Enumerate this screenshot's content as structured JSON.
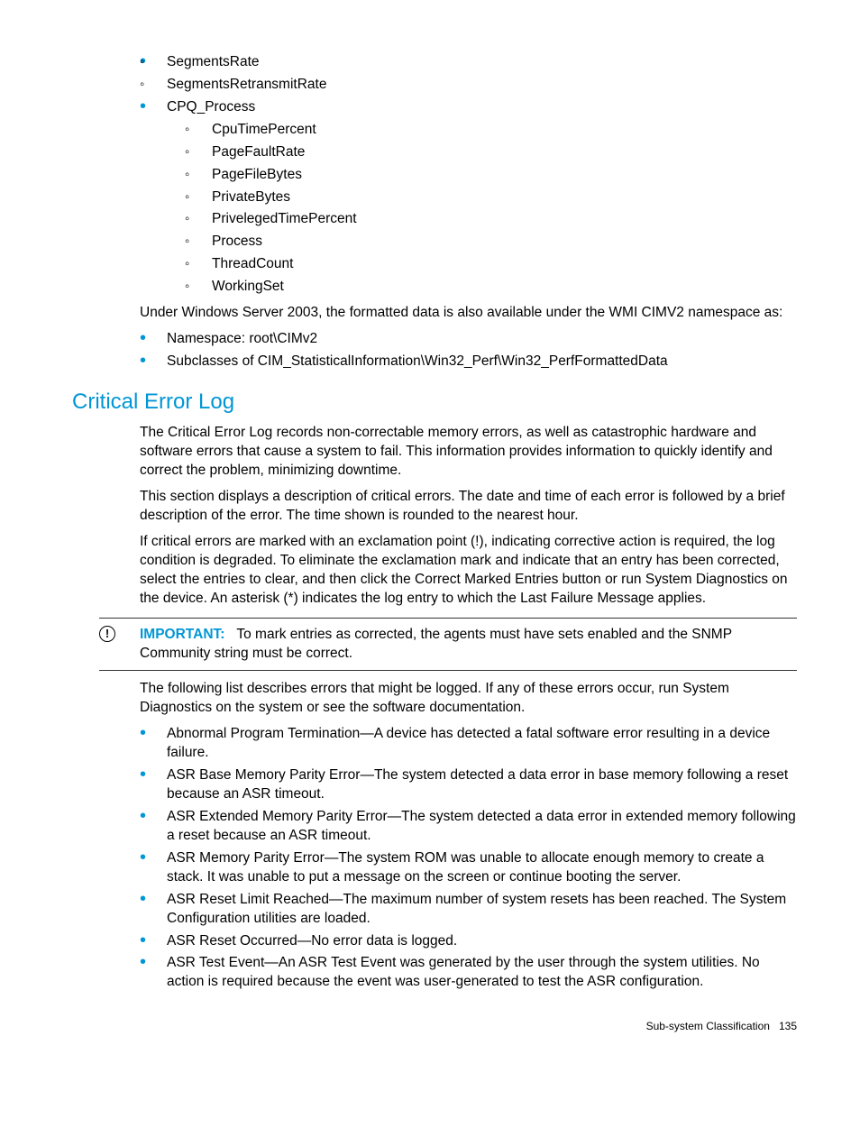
{
  "top_circle_items": [
    "SegmentsRate",
    "SegmentsRetransmitRate"
  ],
  "cpq_section": {
    "label": "CPQ_Process",
    "items": [
      "CpuTimePercent",
      "PageFaultRate",
      "PageFileBytes",
      "PrivateBytes",
      "PrivelegedTimePercent",
      "Process",
      "ThreadCount",
      "WorkingSet"
    ]
  },
  "wmi_text": "Under Windows Server 2003, the formatted data is also available under the WMI CIMV2 namespace as:",
  "wmi_items": [
    "Namespace: root\\CIMv2",
    "Subclasses of CIM_StatisticalInformation\\Win32_Perf\\Win32_PerfFormattedData"
  ],
  "section_heading": "Critical Error Log",
  "para1": "The Critical Error Log records non-correctable memory errors, as well as catastrophic hardware and software errors that cause a system to fail. This information provides information to quickly identify and correct the problem, minimizing downtime.",
  "para2": "This section displays a description of critical errors. The date and time of each error is followed by a brief description of the error. The time shown is rounded to the nearest hour.",
  "para3": "If critical errors are marked with an exclamation point (!), indicating corrective action is required, the log condition is degraded. To eliminate the exclamation mark and indicate that an entry has been corrected, select the entries to clear, and then click the Correct Marked Entries button or run System Diagnostics on the device. An asterisk (*) indicates the log entry to which the Last Failure Message applies.",
  "important_label": "IMPORTANT:",
  "important_text": "To mark entries as corrected, the agents must have sets enabled and the SNMP Community string must be correct.",
  "para4": "The following list describes errors that might be logged. If any of these errors occur, run System Diagnostics on the system or see the software documentation.",
  "error_items": [
    "Abnormal Program Termination—A device has detected a fatal software error resulting in a device failure.",
    "ASR Base Memory Parity Error—The system detected a data error in base memory following a reset because an ASR timeout.",
    "ASR Extended Memory Parity Error—The system detected a data error in extended memory following a reset because an ASR timeout.",
    "ASR Memory Parity Error—The system ROM was unable to allocate enough memory to create a stack. It was unable to put a message on the screen or continue booting the server.",
    "ASR Reset Limit Reached—The maximum number of system resets has been reached. The System Configuration utilities are loaded.",
    "ASR Reset Occurred—No error data is logged.",
    "ASR Test Event—An ASR Test Event was generated by the user through the system utilities. No action is required because the event was user-generated to test the ASR configuration."
  ],
  "footer_label": "Sub-system Classification",
  "footer_page": "135"
}
